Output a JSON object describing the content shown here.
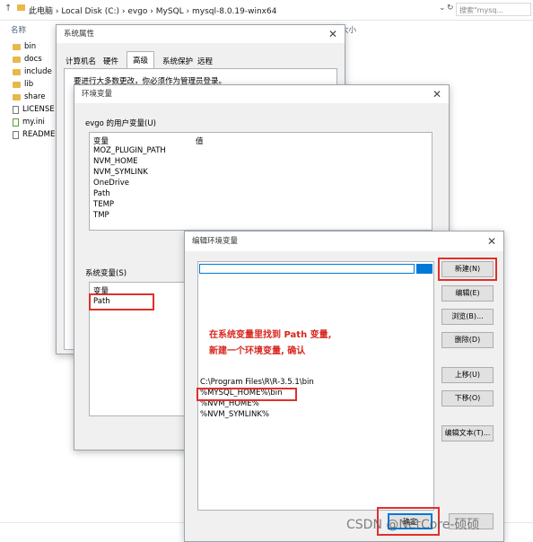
{
  "explorer": {
    "path": "此电脑  ›  Local Disk (C:)  ›  evgo  ›  MySQL  ›  mysql-8.0.19-winx64",
    "search_placeholder": "搜索\"mysq...",
    "col_name": "名称",
    "col_size": "大小",
    "files": [
      {
        "name": "bin",
        "kind": "folder"
      },
      {
        "name": "docs",
        "kind": "folder"
      },
      {
        "name": "include",
        "kind": "folder"
      },
      {
        "name": "lib",
        "kind": "folder"
      },
      {
        "name": "share",
        "kind": "folder"
      },
      {
        "name": "LICENSE",
        "kind": "file"
      },
      {
        "name": "my.ini",
        "kind": "file"
      },
      {
        "name": "README",
        "kind": "file"
      }
    ]
  },
  "sysprops": {
    "title": "系统属性",
    "tabs": [
      "计算机名",
      "硬件",
      "高级",
      "系统保护",
      "远程"
    ],
    "notice": "要进行大多数更改，你必须作为管理员登录。"
  },
  "envvars": {
    "title": "环境变量",
    "user_section": "evgo 的用户变量(U)",
    "col_var": "变量",
    "col_val": "值",
    "user_vars": [
      "MOZ_PLUGIN_PATH",
      "NVM_HOME",
      "NVM_SYMLINK",
      "OneDrive",
      "Path",
      "TEMP",
      "TMP"
    ],
    "system_section": "系统变量(S)",
    "system_vars": [
      "Path"
    ]
  },
  "editor": {
    "title": "编辑环境变量",
    "entries": [
      "C:\\Program Files\\R\\R-3.5.1\\bin",
      "%MYSQL_HOME%\\bin",
      "%NVM_HOME%",
      "%NVM_SYMLINK%"
    ],
    "annotation_line1": "在系统变量里找到 Path 变量,",
    "annotation_line2": "新建一个环境变量, 确认",
    "buttons": {
      "new": "新建(N)",
      "edit": "编辑(E)",
      "browse": "浏览(B)...",
      "delete": "删除(D)",
      "up": "上移(U)",
      "down": "下移(O)",
      "edit_text": "编辑文本(T)...",
      "ok": "确定"
    }
  },
  "watermark": "CSDN @NetCore-硕硕",
  "colors": {
    "highlight": "#e0302a",
    "selection": "#0078d7",
    "annotation": "#d8261e"
  }
}
